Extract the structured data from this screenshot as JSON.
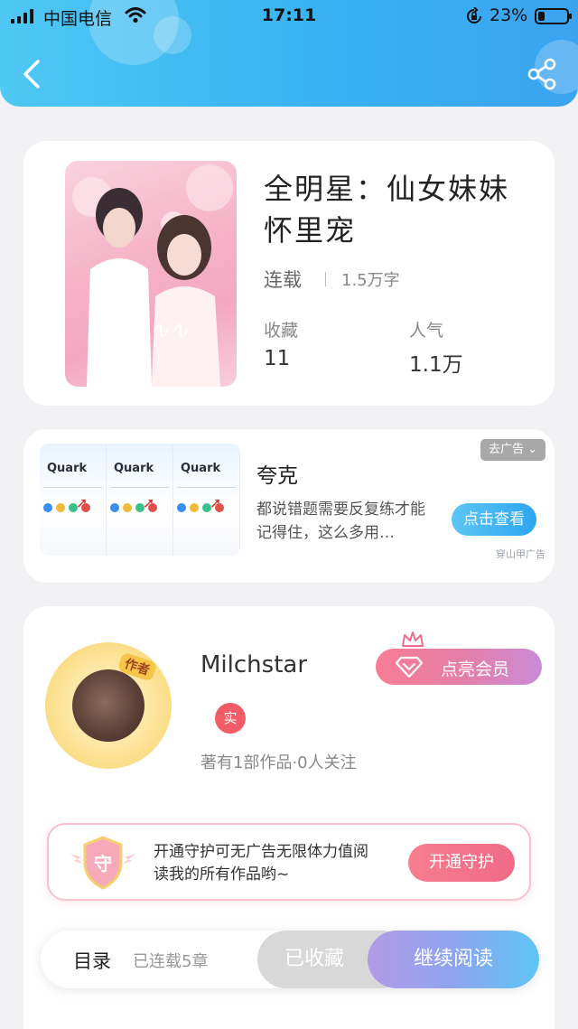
{
  "status_bar": {
    "carrier": "中国电信",
    "time": "17:11",
    "battery_percent": "23%",
    "battery_level": 0.23
  },
  "header": {
    "back_icon": "chevron-left-icon",
    "share_icon": "share-icon"
  },
  "book": {
    "title": "全明星：仙女妹妹怀里宠",
    "status": "连载",
    "word_count": "1.5万字",
    "stats": [
      {
        "label": "收藏",
        "value": "11"
      },
      {
        "label": "人气",
        "value": "1.1万"
      }
    ]
  },
  "ad": {
    "close_label": "去广告",
    "brand": "Quark",
    "title": "夸克",
    "description": "都说错题需要反复练才能记得住，这么多用…",
    "cta": "点击查看",
    "source": "穿山甲广告"
  },
  "author": {
    "avatar_tag": "作者",
    "name": "Milchstar",
    "vip_button": "点亮会员",
    "real_badge": "实",
    "meta": "著有1部作品·0人关注"
  },
  "guard": {
    "badge": "守",
    "text": "开通守护可无广告无限体力值阅读我的所有作品哟~",
    "button": "开通守护"
  },
  "bottom_bar": {
    "toc": "目录",
    "chapters": "已连载5章",
    "collected": "已收藏",
    "continue": "继续阅读"
  },
  "colors": {
    "header": "#39b2f2",
    "accent_pink": "#f77e8f",
    "accent_blue": "#2ea5ef"
  }
}
